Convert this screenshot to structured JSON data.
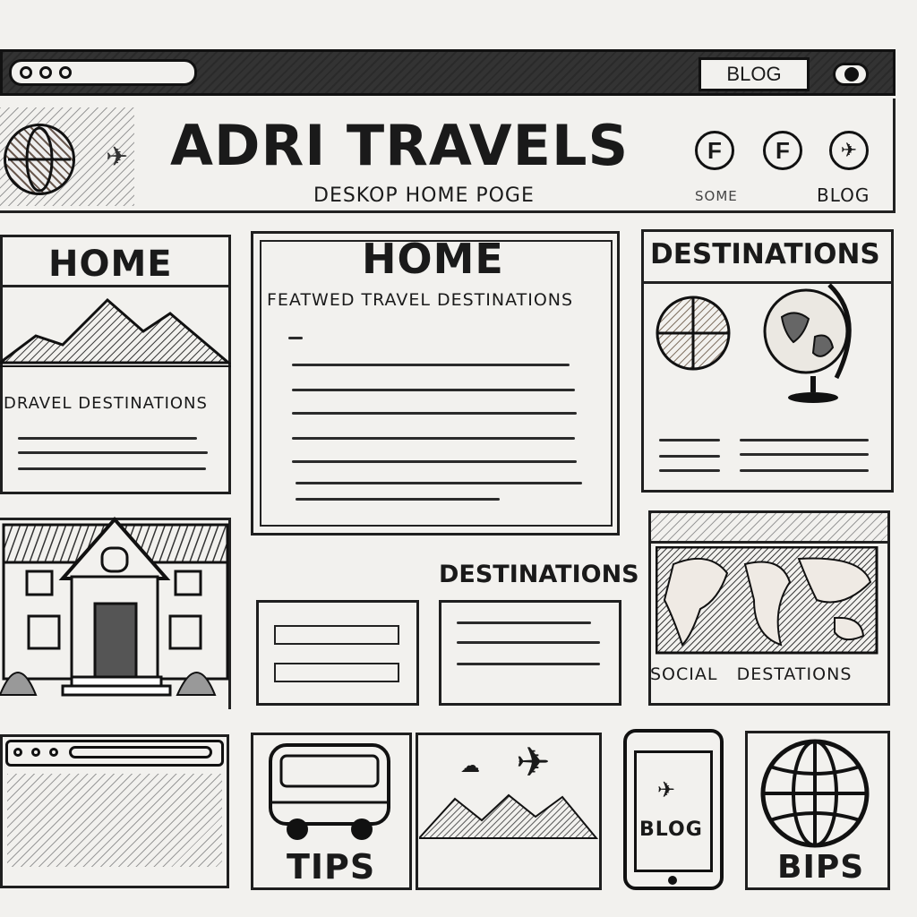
{
  "browser": {
    "top_button_label": "BLOG"
  },
  "header": {
    "site_title": "ADRI TRAVELS",
    "page_subtitle": "DESKOP HOME POGE",
    "nav_home": "SOME",
    "nav_blog": "BLOG",
    "social": [
      {
        "icon": "facebook-icon",
        "glyph": "F"
      },
      {
        "icon": "facebook-icon",
        "glyph": "F"
      },
      {
        "icon": "twitter-icon",
        "glyph": "✈"
      }
    ]
  },
  "left_card": {
    "title": "HOME",
    "caption": "DRAVEL DESTINATIONS"
  },
  "center_card": {
    "title": "HOME",
    "subtitle": "FEATWED TRAVEL DESTINATIONS"
  },
  "right_card": {
    "title": "DESTINATIONS"
  },
  "middle_section": {
    "title": "DESTINATIONS"
  },
  "map_card": {
    "caption": "SOCIAL   DESTATIONS"
  },
  "bottom_row": {
    "tips_label": "TIPS",
    "phone_label": "BLOG",
    "globe_label": "BIPS"
  }
}
